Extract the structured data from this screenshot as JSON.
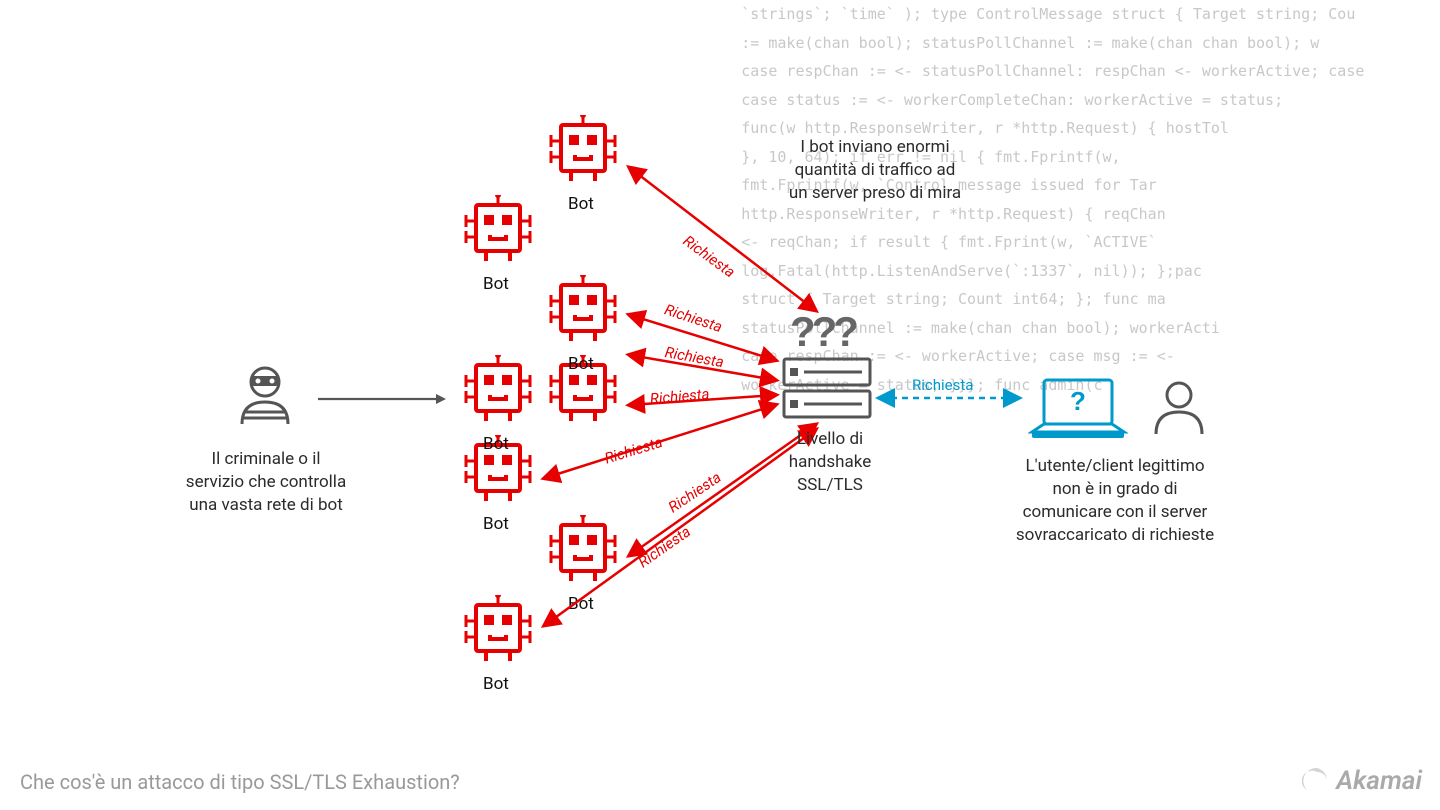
{
  "criminal_caption": "Il criminale o il\nservizio che controlla\nuna vasta rete di bot",
  "bots_caption": "I bot inviano enormi\nquantità di traffico ad\nun server preso di mira",
  "server_caption": "Livello di\nhandshake\nSSL/TLS",
  "user_caption": "L'utente/client legittimo\nnon è in grado di\ncomunicare con il server\nsovraccaricato di richieste",
  "bot_label": "Bot",
  "request_label": "Richiesta",
  "footer_title": "Che cos'è un attacco di tipo SSL/TLS Exhaustion?",
  "logo_text": "Akamai",
  "code_bg": "         `strings`; `time` ); type ControlMessage struct { Target string; Cou\n         := make(chan bool); statusPollChannel := make(chan chan bool); w\n         case respChan := <- statusPollChannel: respChan <- workerActive; case\n         case status := <- workerCompleteChan: workerActive = status;\n         func(w http.ResponseWriter, r *http.Request) { hostTol\n         }, 10, 64); if err != nil { fmt.Fprintf(w,\n         fmt.Fprintf(w, `Control message issued for Tar\n         http.ResponseWriter, r *http.Request) { reqChan\n         <- reqChan; if result { fmt.Fprint(w, `ACTIVE`\n         log.Fatal(http.ListenAndServe(`:1337`, nil)); };pac\n         struct { Target string; Count int64; }; func ma\n         statusPollChannel := make(chan chan bool); workerActi\n         case respChan := <- workerActive; case msg := <-\n         workerActive = status; }}}; func admin(c\n         *http.Request) { hostTokens\n         ); if err != nil { fmt.Fprintf(w,\n         ssage issued for Tar\n         ) { reqChan\n         t(w, `ACTIVE`\n         , nil)); };pa\n         ; func m\n         workerAct\n"
}
